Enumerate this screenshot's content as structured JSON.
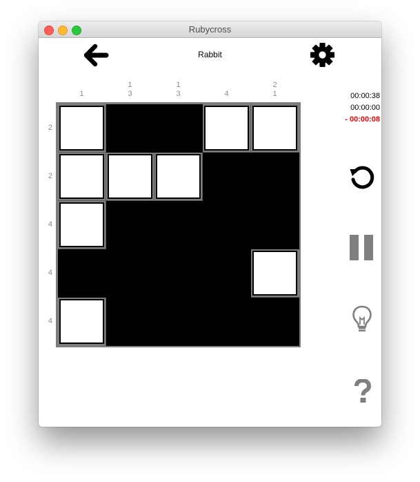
{
  "window": {
    "title": "Rubycross"
  },
  "toolbar": {
    "back_icon": "arrow-left-icon",
    "settings_icon": "gear-icon"
  },
  "puzzle": {
    "name": "Rabbit",
    "size": 5,
    "column_clues": [
      [
        "1"
      ],
      [
        "1",
        "3"
      ],
      [
        "1",
        "3"
      ],
      [
        "4"
      ],
      [
        "2",
        "1"
      ]
    ],
    "row_clues": [
      "2",
      "2",
      "4",
      "4",
      "4"
    ],
    "grid": [
      [
        0,
        1,
        1,
        0,
        0
      ],
      [
        0,
        0,
        0,
        1,
        1
      ],
      [
        0,
        1,
        1,
        1,
        1
      ],
      [
        1,
        1,
        1,
        1,
        0
      ],
      [
        0,
        1,
        1,
        1,
        1
      ]
    ]
  },
  "timers": {
    "elapsed": "00:00:38",
    "second": "00:00:00",
    "penalty": "- 00:00:08"
  },
  "side_controls": [
    "restart-icon",
    "pause-icon",
    "hint-lightbulb-icon",
    "help-question-icon"
  ],
  "colors": {
    "filled": "#000000",
    "empty": "#ffffff",
    "penalty": "#ff0000",
    "clue": "#8a8a8a",
    "icon": "#7f7f7f"
  }
}
